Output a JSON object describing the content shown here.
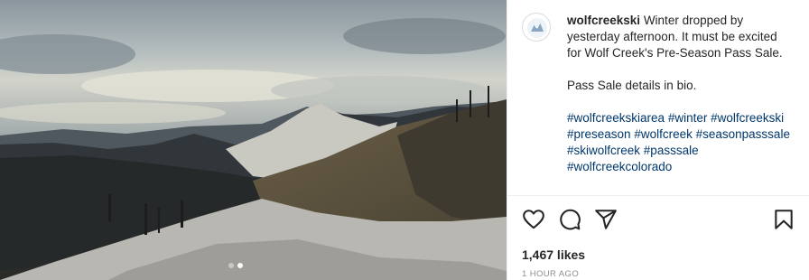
{
  "post": {
    "username": "wolfcreekski",
    "caption_text": "Winter dropped by yesterday afternoon. It must be excited for Wolf Creek's Pre-Season Pass Sale.",
    "caption_line2": "Pass Sale details in bio.",
    "hashtags": [
      "#wolfcreekskiarea",
      "#winter",
      "#wolfcreekski",
      "#preseason",
      "#wolfcreek",
      "#seasonpasssale",
      "#skiwolfcreek",
      "#passsale",
      "#wolfcreekcolorado"
    ],
    "likes": "1,467 likes",
    "timestamp": "1 HOUR AGO"
  },
  "carousel": {
    "count": 2,
    "active": 2
  },
  "icons": {
    "like": "heart-icon",
    "comment": "comment-icon",
    "share": "paper-plane-icon",
    "save": "bookmark-icon"
  },
  "colors": {
    "hashtag": "#00376b",
    "text": "#262626",
    "muted": "#8e8e8e"
  }
}
